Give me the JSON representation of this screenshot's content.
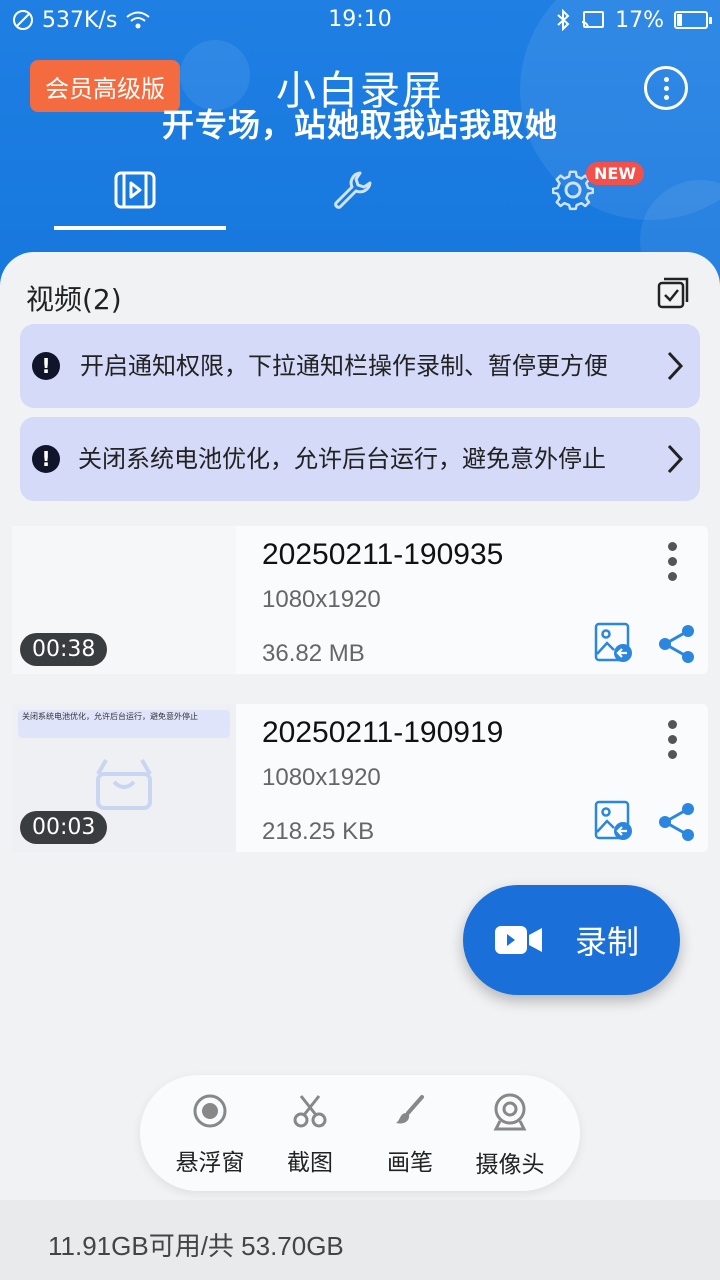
{
  "status_bar": {
    "network_speed": "537K/s",
    "time": "19:10",
    "battery_percent": "17%",
    "battery_level": 0.17
  },
  "header": {
    "vip_badge": "会员高级版",
    "app_title": "小白录屏",
    "overlay_text": "开专场，站她取我站我取她",
    "new_badge": "NEW",
    "tabs": [
      "video-tab",
      "tools-tab",
      "settings-tab"
    ]
  },
  "videos_section": {
    "title": "视频(2)"
  },
  "notices": [
    {
      "text": "开启通知权限，下拉通知栏操作录制、暂停更方便"
    },
    {
      "text": "关闭系统电池优化，允许后台运行，避免意外停止"
    }
  ],
  "videos": [
    {
      "name": "20250211-190935",
      "resolution": "1080x1920",
      "size": "36.82 MB",
      "duration": "00:38"
    },
    {
      "name": "20250211-190919",
      "resolution": "1080x1920",
      "size": "218.25 KB",
      "duration": "00:03",
      "thumbnail_text": "关闭系统电池优化，允许后台运行，避免意外停止"
    }
  ],
  "record_button": {
    "label": "录制"
  },
  "tools": [
    {
      "label": "悬浮窗",
      "icon": "record-dot-icon"
    },
    {
      "label": "截图",
      "icon": "scissors-icon"
    },
    {
      "label": "画笔",
      "icon": "brush-icon"
    },
    {
      "label": "摄像头",
      "icon": "camera-icon"
    }
  ],
  "storage": {
    "text": "11.91GB可用/共 53.70GB"
  },
  "colors": {
    "primary": "#1677dd",
    "vip": "#f36b3f",
    "notice_bg": "#d4daf7",
    "share": "#2b86e0"
  }
}
